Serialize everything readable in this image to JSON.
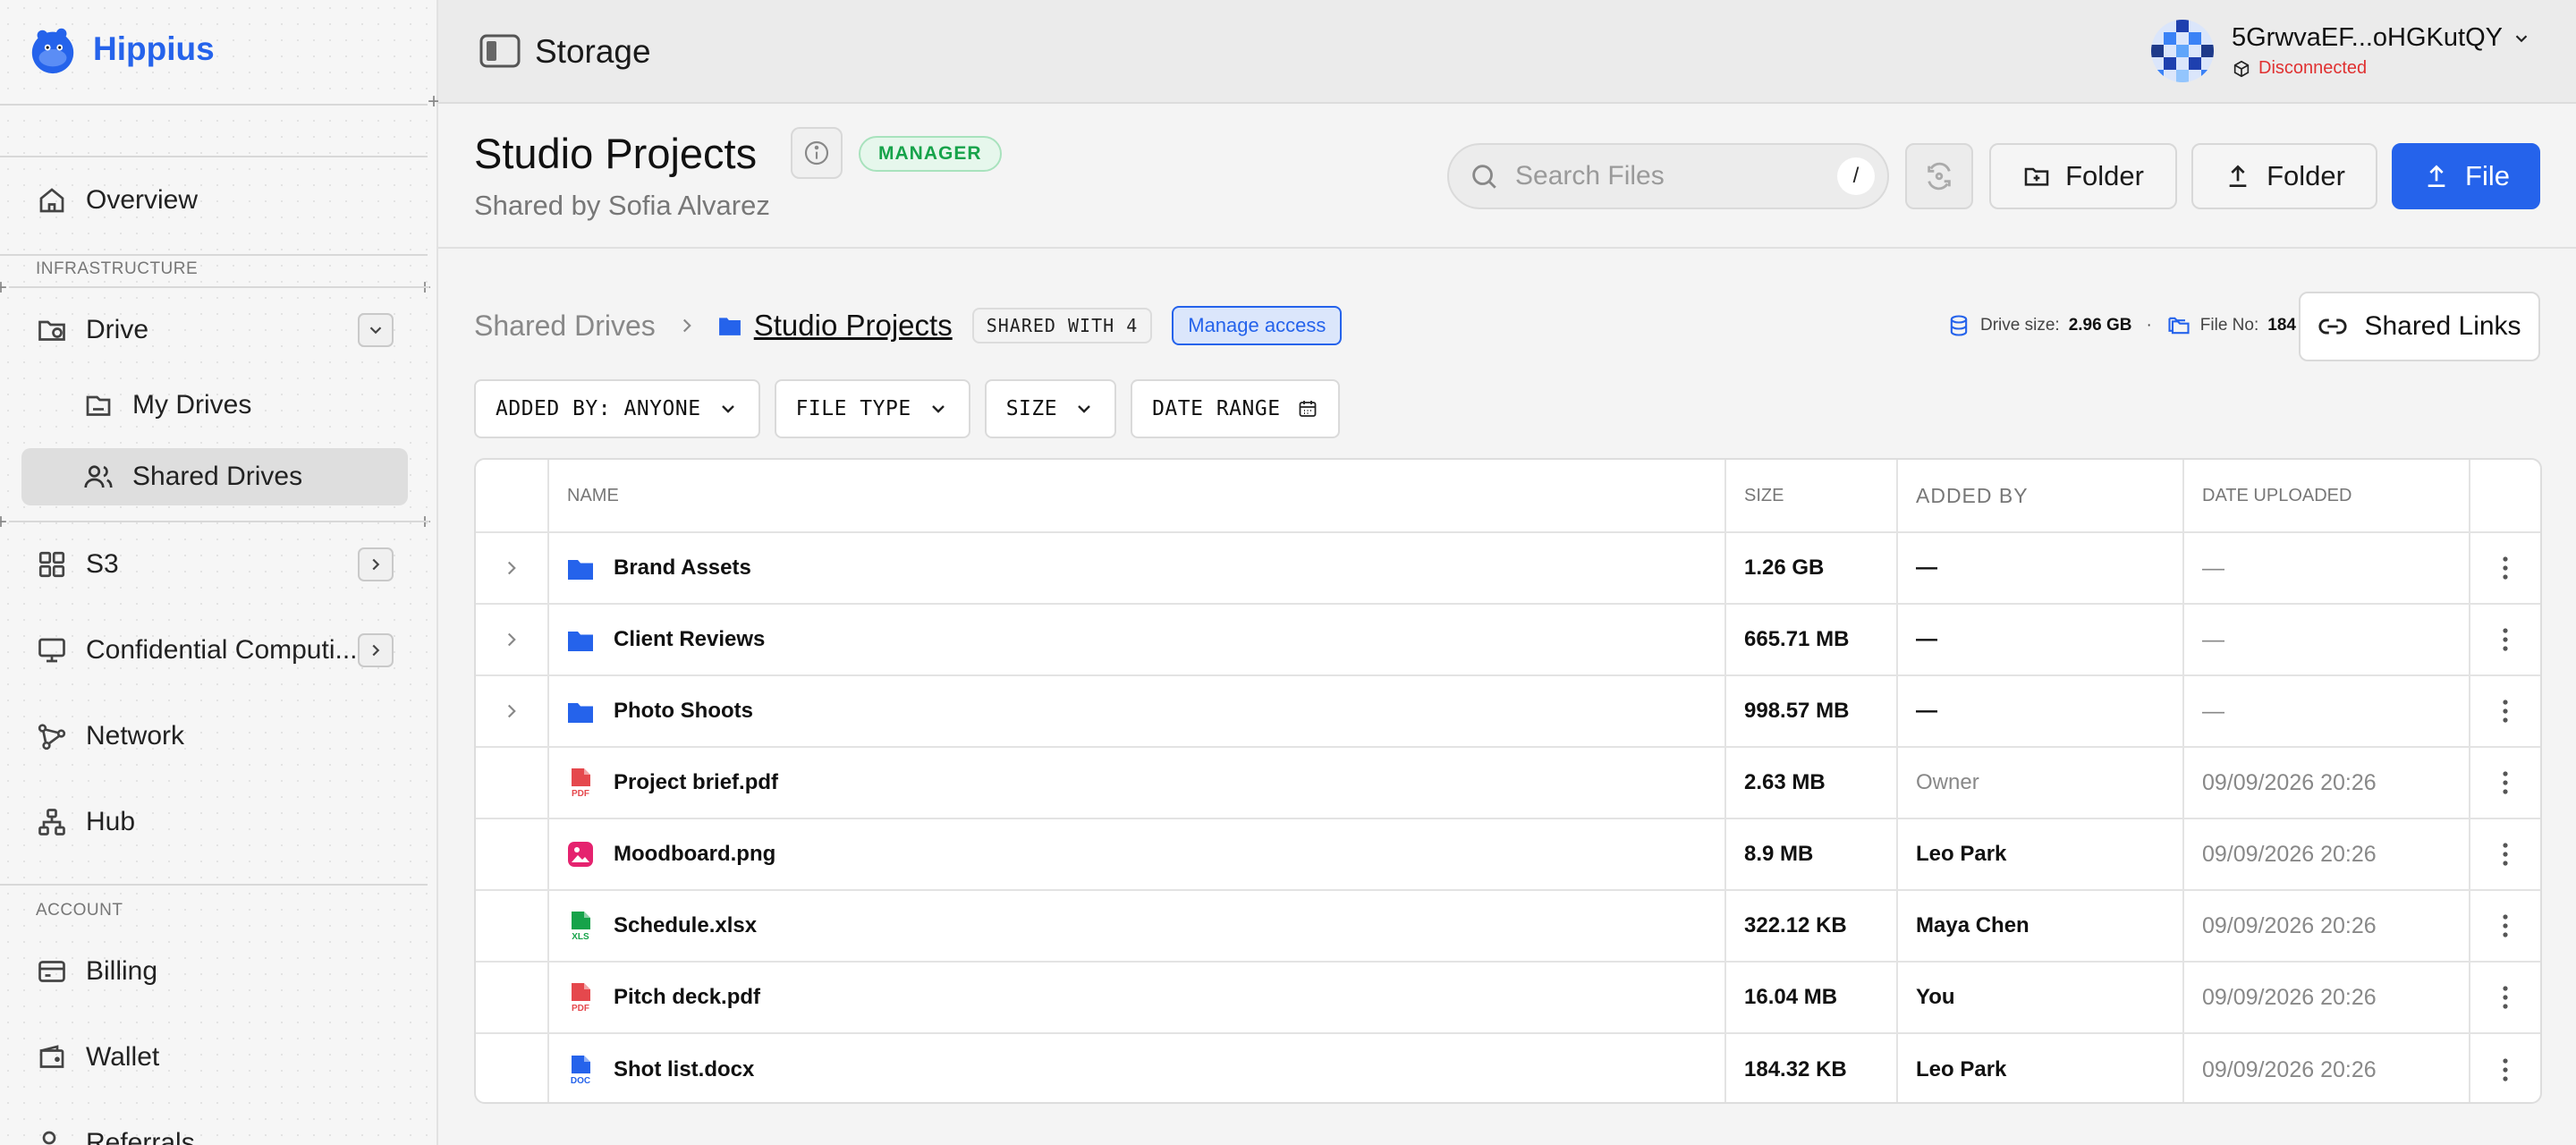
{
  "app": {
    "name": "Hippius"
  },
  "sidebar": {
    "overview": "Overview",
    "section_infrastructure": "INFRASTRUCTURE",
    "drive": "Drive",
    "my_drives": "My Drives",
    "shared_drives": "Shared Drives",
    "s3": "S3",
    "confidential": "Confidential Computi...",
    "network": "Network",
    "hub": "Hub",
    "section_account": "ACCOUNT",
    "billing": "Billing",
    "wallet": "Wallet",
    "referrals": "Referrals"
  },
  "topbar": {
    "title": "Storage",
    "account_address": "5GrwvaEF...oHGKutQY",
    "account_status": "Disconnected"
  },
  "header": {
    "title": "Studio Projects",
    "role": "MANAGER",
    "shared_by": "Shared by Sofia Alvarez",
    "search_placeholder": "Search Files",
    "search_shortcut": "/",
    "new_folder_label": "Folder",
    "upload_folder_label": "Folder",
    "upload_file_label": "File"
  },
  "toolbar": {
    "breadcrumb_root": "Shared Drives",
    "breadcrumb_current": "Studio Projects",
    "shared_with": "SHARED WITH 4",
    "manage_access": "Manage access",
    "drive_size_label": "Drive size:",
    "drive_size_value": "2.96 GB",
    "separator": "·",
    "file_no_label": "File No:",
    "file_no_value": "184",
    "shared_links": "Shared Links"
  },
  "filters": {
    "added_by": "ADDED BY: ANYONE",
    "file_type": "FILE TYPE",
    "size": "SIZE",
    "date_range": "DATE RANGE"
  },
  "table": {
    "headers": {
      "name": "NAME",
      "size": "SIZE",
      "added_by": "ADDED BY",
      "date": "DATE UPLOADED"
    },
    "rows": [
      {
        "name": "Brand Assets",
        "size": "1.26 GB",
        "added_by": "—",
        "date": "—",
        "type": "folder-icon",
        "expandable": true
      },
      {
        "name": "Client Reviews",
        "size": "665.71 MB",
        "added_by": "—",
        "date": "—",
        "type": "folder-icon",
        "expandable": true
      },
      {
        "name": "Photo Shoots",
        "size": "998.57 MB",
        "added_by": "—",
        "date": "—",
        "type": "folder-icon",
        "expandable": true
      },
      {
        "name": "Project brief.pdf",
        "size": "2.63 MB",
        "added_by": "Owner",
        "date": "09/09/2026 20:26",
        "type": "pdf-icon",
        "expandable": false
      },
      {
        "name": "Moodboard.png",
        "size": "8.9 MB",
        "added_by": "Leo Park",
        "date": "09/09/2026 20:26",
        "type": "image-icon",
        "expandable": false
      },
      {
        "name": "Schedule.xlsx",
        "size": "322.12 KB",
        "added_by": "Maya Chen",
        "date": "09/09/2026 20:26",
        "type": "xls-icon",
        "expandable": false
      },
      {
        "name": "Pitch deck.pdf",
        "size": "16.04 MB",
        "added_by": "You",
        "date": "09/09/2026 20:26",
        "type": "pdf-icon",
        "expandable": false
      },
      {
        "name": "Shot list.docx",
        "size": "184.32 KB",
        "added_by": "Leo Park",
        "date": "09/09/2026 20:26",
        "type": "doc-icon",
        "expandable": false
      }
    ]
  },
  "icon_labels": {
    "pdf": "PDF",
    "xls": "XLS",
    "doc": "DOC"
  },
  "colors": {
    "accent": "#2563eb",
    "success": "#16a34a",
    "danger": "#e03131",
    "pdf": "#e5484d",
    "xls": "#16a34a",
    "image": "#e5236f"
  }
}
